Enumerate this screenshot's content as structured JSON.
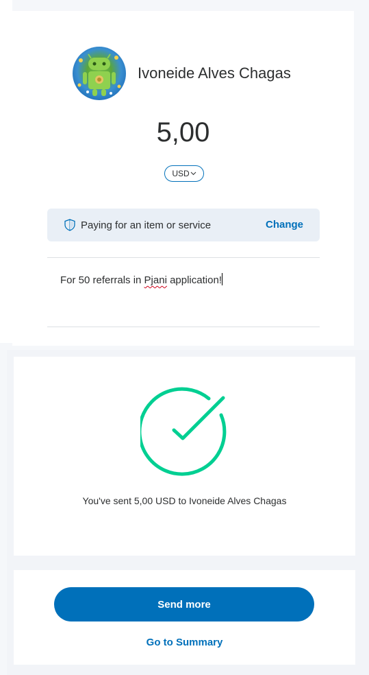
{
  "recipient": {
    "name": "Ivoneide Alves Chagas",
    "avatar_icon": "android-avatar"
  },
  "amount": {
    "value": "5,00",
    "currency": "USD"
  },
  "purpose": {
    "label": "Paying for an item or service",
    "change_label": "Change",
    "icon": "shield-icon"
  },
  "note": {
    "before": "For 50 referrals in ",
    "misspelled": "Pjani",
    "after": " application!"
  },
  "success": {
    "message": "You've sent 5,00 USD to Ivoneide Alves Chagas",
    "icon": "check-circle-icon",
    "color": "#00cf92"
  },
  "actions": {
    "send_more": "Send more",
    "go_summary": "Go to Summary"
  },
  "colors": {
    "brand": "#0070ba",
    "purpose_bg": "#e9eff6"
  }
}
